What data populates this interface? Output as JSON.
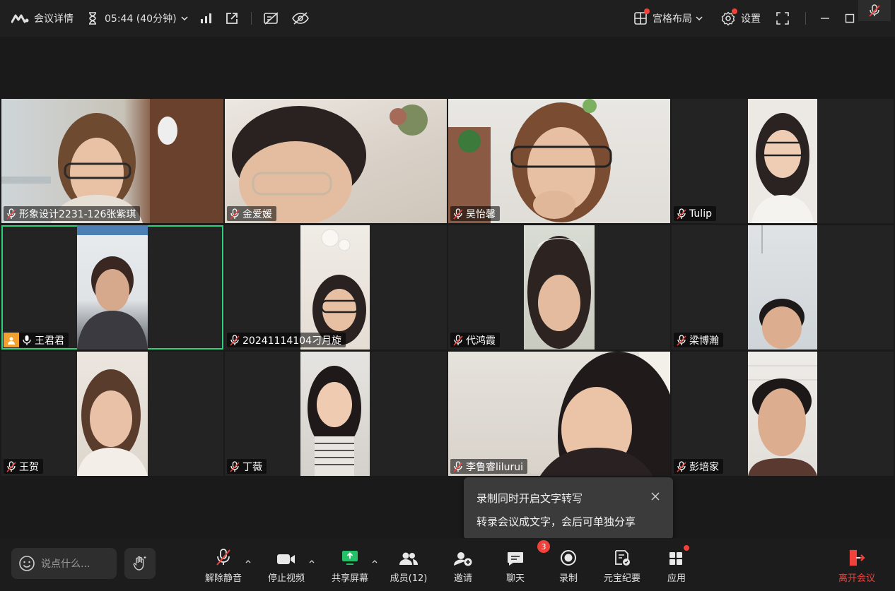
{
  "topbar": {
    "meeting_details": "会议详情",
    "timer": "05:44 (40分钟)",
    "layout_label": "宫格布局",
    "settings_label": "设置"
  },
  "participants": [
    {
      "name": "形象设计2231-126张紫琪",
      "mic": "muted"
    },
    {
      "name": "金爱媛",
      "mic": "muted"
    },
    {
      "name": "吴怡馨",
      "mic": "muted"
    },
    {
      "name": "Tulip",
      "mic": "muted"
    },
    {
      "name": "王君君",
      "mic": "on",
      "speaking": true
    },
    {
      "name": "20241114104刁月旋",
      "mic": "muted"
    },
    {
      "name": "代鸿霞",
      "mic": "muted"
    },
    {
      "name": "梁博瀚",
      "mic": "muted"
    },
    {
      "name": "王贺",
      "mic": "muted"
    },
    {
      "name": "丁薇",
      "mic": "muted"
    },
    {
      "name": "李鲁睿lilurui",
      "mic": "muted"
    },
    {
      "name": "彭培家",
      "mic": "muted"
    }
  ],
  "tooltip": {
    "line1": "录制同时开启文字转写",
    "line2": "转录会议成文字，会后可单独分享"
  },
  "toolbar": {
    "chat_placeholder": "说点什么...",
    "unmute": "解除静音",
    "stop_video": "停止视频",
    "share_screen": "共享屏幕",
    "members": "成员(12)",
    "invite": "邀请",
    "chat": "聊天",
    "chat_badge": "3",
    "record": "录制",
    "ai_minutes": "元宝纪要",
    "apps": "应用",
    "leave": "离开会议"
  },
  "colors": {
    "speaking_border": "#2fd07a",
    "leave_red": "#f0413a",
    "notify_dot": "#f0413a",
    "share_green": "#25c067",
    "user_badge": "#f2a12e"
  }
}
